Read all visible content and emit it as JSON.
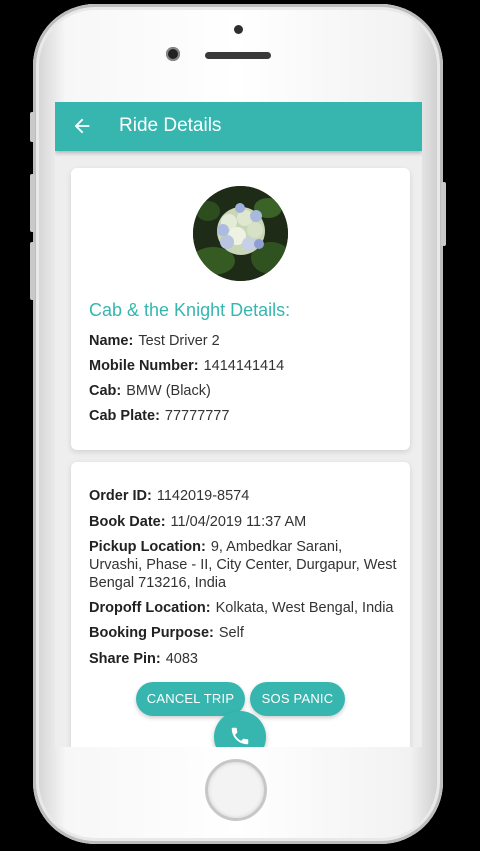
{
  "appbar": {
    "title": "Ride Details",
    "back_icon": "arrow-left-icon"
  },
  "driver_card": {
    "avatar_icon": "hydrangea-photo",
    "section_title": "Cab & the Knight Details:",
    "rows": [
      {
        "label": "Name:",
        "value": "Test Driver 2"
      },
      {
        "label": "Mobile Number:",
        "value": "1414141414"
      },
      {
        "label": "Cab:",
        "value": "BMW (Black)"
      },
      {
        "label": "Cab Plate:",
        "value": "77777777"
      }
    ]
  },
  "order_card": {
    "order_id": {
      "label": "Order ID:",
      "value": "1142019-8574"
    },
    "book_date": {
      "label": "Book Date:",
      "value": "11/04/2019 11:37 AM"
    },
    "pickup": {
      "label": "Pickup Location:",
      "value": "9, Ambedkar Sarani, Urvashi, Phase - II, City Center, Durgapur, West Bengal 713216, India"
    },
    "dropoff": {
      "label": "Dropoff Location:",
      "value": "Kolkata, West Bengal, India"
    },
    "purpose": {
      "label": "Booking Purpose:",
      "value": "Self"
    },
    "share_pin": {
      "label": "Share Pin:",
      "value": "4083"
    }
  },
  "actions": {
    "cancel_label": "CANCEL TRIP",
    "sos_label": "SOS PANIC",
    "call_icon": "phone-icon"
  },
  "colors": {
    "primary": "#37b6b0",
    "background": "#eeeeee",
    "card": "#ffffff"
  }
}
